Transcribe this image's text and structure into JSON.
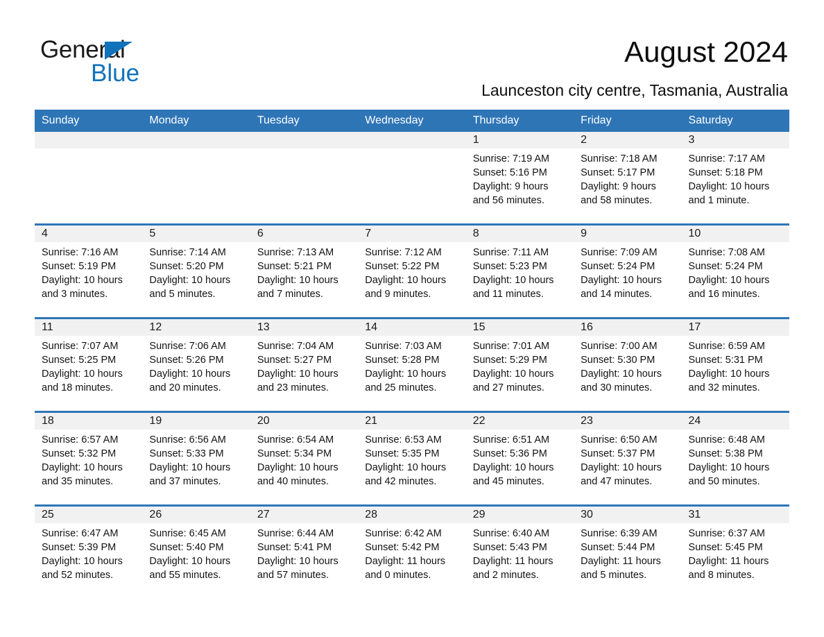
{
  "brand": {
    "name_part1": "General",
    "name_part2": "Blue",
    "accent_color": "#1072ba"
  },
  "header": {
    "title": "August 2024",
    "subtitle": "Launceston city centre, Tasmania, Australia"
  },
  "theme": {
    "header_blue": "#2e75b6",
    "daynum_band": "#f1f1f1",
    "text": "#131313"
  },
  "weekday_headers": [
    "Sunday",
    "Monday",
    "Tuesday",
    "Wednesday",
    "Thursday",
    "Friday",
    "Saturday"
  ],
  "weeks": [
    [
      {
        "day": "",
        "sunrise": "",
        "sunset": "",
        "daylight1": "",
        "daylight2": ""
      },
      {
        "day": "",
        "sunrise": "",
        "sunset": "",
        "daylight1": "",
        "daylight2": ""
      },
      {
        "day": "",
        "sunrise": "",
        "sunset": "",
        "daylight1": "",
        "daylight2": ""
      },
      {
        "day": "",
        "sunrise": "",
        "sunset": "",
        "daylight1": "",
        "daylight2": ""
      },
      {
        "day": "1",
        "sunrise": "Sunrise: 7:19 AM",
        "sunset": "Sunset: 5:16 PM",
        "daylight1": "Daylight: 9 hours",
        "daylight2": "and 56 minutes."
      },
      {
        "day": "2",
        "sunrise": "Sunrise: 7:18 AM",
        "sunset": "Sunset: 5:17 PM",
        "daylight1": "Daylight: 9 hours",
        "daylight2": "and 58 minutes."
      },
      {
        "day": "3",
        "sunrise": "Sunrise: 7:17 AM",
        "sunset": "Sunset: 5:18 PM",
        "daylight1": "Daylight: 10 hours",
        "daylight2": "and 1 minute."
      }
    ],
    [
      {
        "day": "4",
        "sunrise": "Sunrise: 7:16 AM",
        "sunset": "Sunset: 5:19 PM",
        "daylight1": "Daylight: 10 hours",
        "daylight2": "and 3 minutes."
      },
      {
        "day": "5",
        "sunrise": "Sunrise: 7:14 AM",
        "sunset": "Sunset: 5:20 PM",
        "daylight1": "Daylight: 10 hours",
        "daylight2": "and 5 minutes."
      },
      {
        "day": "6",
        "sunrise": "Sunrise: 7:13 AM",
        "sunset": "Sunset: 5:21 PM",
        "daylight1": "Daylight: 10 hours",
        "daylight2": "and 7 minutes."
      },
      {
        "day": "7",
        "sunrise": "Sunrise: 7:12 AM",
        "sunset": "Sunset: 5:22 PM",
        "daylight1": "Daylight: 10 hours",
        "daylight2": "and 9 minutes."
      },
      {
        "day": "8",
        "sunrise": "Sunrise: 7:11 AM",
        "sunset": "Sunset: 5:23 PM",
        "daylight1": "Daylight: 10 hours",
        "daylight2": "and 11 minutes."
      },
      {
        "day": "9",
        "sunrise": "Sunrise: 7:09 AM",
        "sunset": "Sunset: 5:24 PM",
        "daylight1": "Daylight: 10 hours",
        "daylight2": "and 14 minutes."
      },
      {
        "day": "10",
        "sunrise": "Sunrise: 7:08 AM",
        "sunset": "Sunset: 5:24 PM",
        "daylight1": "Daylight: 10 hours",
        "daylight2": "and 16 minutes."
      }
    ],
    [
      {
        "day": "11",
        "sunrise": "Sunrise: 7:07 AM",
        "sunset": "Sunset: 5:25 PM",
        "daylight1": "Daylight: 10 hours",
        "daylight2": "and 18 minutes."
      },
      {
        "day": "12",
        "sunrise": "Sunrise: 7:06 AM",
        "sunset": "Sunset: 5:26 PM",
        "daylight1": "Daylight: 10 hours",
        "daylight2": "and 20 minutes."
      },
      {
        "day": "13",
        "sunrise": "Sunrise: 7:04 AM",
        "sunset": "Sunset: 5:27 PM",
        "daylight1": "Daylight: 10 hours",
        "daylight2": "and 23 minutes."
      },
      {
        "day": "14",
        "sunrise": "Sunrise: 7:03 AM",
        "sunset": "Sunset: 5:28 PM",
        "daylight1": "Daylight: 10 hours",
        "daylight2": "and 25 minutes."
      },
      {
        "day": "15",
        "sunrise": "Sunrise: 7:01 AM",
        "sunset": "Sunset: 5:29 PM",
        "daylight1": "Daylight: 10 hours",
        "daylight2": "and 27 minutes."
      },
      {
        "day": "16",
        "sunrise": "Sunrise: 7:00 AM",
        "sunset": "Sunset: 5:30 PM",
        "daylight1": "Daylight: 10 hours",
        "daylight2": "and 30 minutes."
      },
      {
        "day": "17",
        "sunrise": "Sunrise: 6:59 AM",
        "sunset": "Sunset: 5:31 PM",
        "daylight1": "Daylight: 10 hours",
        "daylight2": "and 32 minutes."
      }
    ],
    [
      {
        "day": "18",
        "sunrise": "Sunrise: 6:57 AM",
        "sunset": "Sunset: 5:32 PM",
        "daylight1": "Daylight: 10 hours",
        "daylight2": "and 35 minutes."
      },
      {
        "day": "19",
        "sunrise": "Sunrise: 6:56 AM",
        "sunset": "Sunset: 5:33 PM",
        "daylight1": "Daylight: 10 hours",
        "daylight2": "and 37 minutes."
      },
      {
        "day": "20",
        "sunrise": "Sunrise: 6:54 AM",
        "sunset": "Sunset: 5:34 PM",
        "daylight1": "Daylight: 10 hours",
        "daylight2": "and 40 minutes."
      },
      {
        "day": "21",
        "sunrise": "Sunrise: 6:53 AM",
        "sunset": "Sunset: 5:35 PM",
        "daylight1": "Daylight: 10 hours",
        "daylight2": "and 42 minutes."
      },
      {
        "day": "22",
        "sunrise": "Sunrise: 6:51 AM",
        "sunset": "Sunset: 5:36 PM",
        "daylight1": "Daylight: 10 hours",
        "daylight2": "and 45 minutes."
      },
      {
        "day": "23",
        "sunrise": "Sunrise: 6:50 AM",
        "sunset": "Sunset: 5:37 PM",
        "daylight1": "Daylight: 10 hours",
        "daylight2": "and 47 minutes."
      },
      {
        "day": "24",
        "sunrise": "Sunrise: 6:48 AM",
        "sunset": "Sunset: 5:38 PM",
        "daylight1": "Daylight: 10 hours",
        "daylight2": "and 50 minutes."
      }
    ],
    [
      {
        "day": "25",
        "sunrise": "Sunrise: 6:47 AM",
        "sunset": "Sunset: 5:39 PM",
        "daylight1": "Daylight: 10 hours",
        "daylight2": "and 52 minutes."
      },
      {
        "day": "26",
        "sunrise": "Sunrise: 6:45 AM",
        "sunset": "Sunset: 5:40 PM",
        "daylight1": "Daylight: 10 hours",
        "daylight2": "and 55 minutes."
      },
      {
        "day": "27",
        "sunrise": "Sunrise: 6:44 AM",
        "sunset": "Sunset: 5:41 PM",
        "daylight1": "Daylight: 10 hours",
        "daylight2": "and 57 minutes."
      },
      {
        "day": "28",
        "sunrise": "Sunrise: 6:42 AM",
        "sunset": "Sunset: 5:42 PM",
        "daylight1": "Daylight: 11 hours",
        "daylight2": "and 0 minutes."
      },
      {
        "day": "29",
        "sunrise": "Sunrise: 6:40 AM",
        "sunset": "Sunset: 5:43 PM",
        "daylight1": "Daylight: 11 hours",
        "daylight2": "and 2 minutes."
      },
      {
        "day": "30",
        "sunrise": "Sunrise: 6:39 AM",
        "sunset": "Sunset: 5:44 PM",
        "daylight1": "Daylight: 11 hours",
        "daylight2": "and 5 minutes."
      },
      {
        "day": "31",
        "sunrise": "Sunrise: 6:37 AM",
        "sunset": "Sunset: 5:45 PM",
        "daylight1": "Daylight: 11 hours",
        "daylight2": "and 8 minutes."
      }
    ]
  ]
}
